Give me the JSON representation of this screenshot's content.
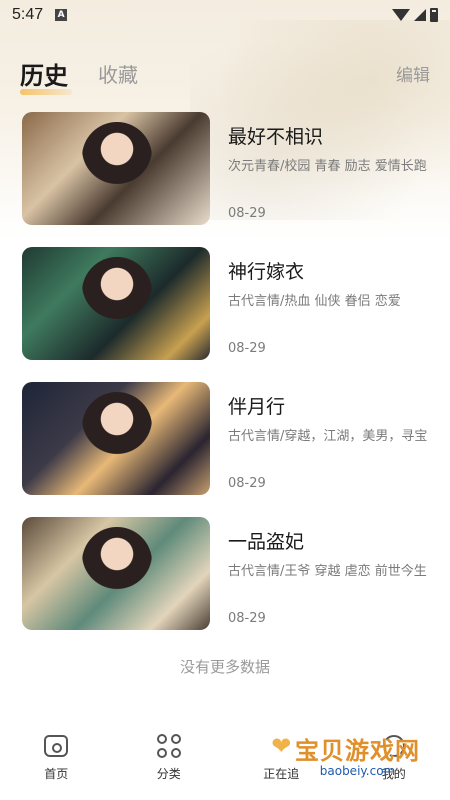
{
  "status": {
    "time": "5:47",
    "notification_badge": "A"
  },
  "header": {
    "tab_history": "历史",
    "tab_favorites": "收藏",
    "edit": "编辑"
  },
  "items": [
    {
      "title": "最好不相识",
      "desc": "次元青春/校园 青春 励志 爱情长跑",
      "date": "08-29"
    },
    {
      "title": "神行嫁衣",
      "desc": "古代言情/热血 仙侠 眷侣 恋爱",
      "date": "08-29"
    },
    {
      "title": "伴月行",
      "desc": "古代言情/穿越，江湖，美男，寻宝",
      "date": "08-29"
    },
    {
      "title": "一品盗妃",
      "desc": "古代言情/王爷 穿越 虐恋 前世今生",
      "date": "08-29"
    }
  ],
  "no_more": "没有更多数据",
  "nav": [
    {
      "label": "首页",
      "icon": "home-icon"
    },
    {
      "label": "分类",
      "icon": "category-icon"
    },
    {
      "label": "正在追",
      "icon": "heart-icon"
    },
    {
      "label": "我的",
      "icon": "user-icon"
    }
  ],
  "watermark": {
    "text": "宝贝游戏网",
    "sub": "baobeiy.com"
  },
  "colors": {
    "accent": "#f5c46a",
    "muted": "#9a9a9a",
    "watermark": "#e0902a"
  }
}
